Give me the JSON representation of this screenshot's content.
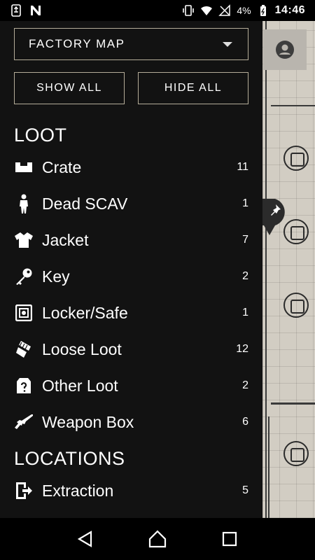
{
  "status_bar": {
    "battery_percent": "4%",
    "time": "14:46",
    "icons": [
      "usb-icon",
      "n-icon",
      "vibrate-icon",
      "wifi-icon",
      "no-signal-icon",
      "battery-icon"
    ]
  },
  "drawer": {
    "map_selector": {
      "value": "FACTORY MAP"
    },
    "show_all_label": "SHOW ALL",
    "hide_all_label": "HIDE ALL",
    "sections": [
      {
        "title": "LOOT",
        "items": [
          {
            "label": "Crate",
            "count": "11",
            "icon": "crate-icon"
          },
          {
            "label": "Dead SCAV",
            "count": "1",
            "icon": "person-icon"
          },
          {
            "label": "Jacket",
            "count": "7",
            "icon": "shirt-icon"
          },
          {
            "label": "Key",
            "count": "2",
            "icon": "key-icon"
          },
          {
            "label": "Locker/Safe",
            "count": "1",
            "icon": "safe-icon"
          },
          {
            "label": "Loose Loot",
            "count": "12",
            "icon": "loose-loot-icon"
          },
          {
            "label": "Other Loot",
            "count": "2",
            "icon": "question-box-icon"
          },
          {
            "label": "Weapon Box",
            "count": "6",
            "icon": "rifle-icon"
          }
        ]
      },
      {
        "title": "LOCATIONS",
        "items": [
          {
            "label": "Extraction",
            "count": "5",
            "icon": "exit-door-icon"
          }
        ]
      }
    ]
  },
  "nav_bar": {
    "buttons": [
      "back-icon",
      "home-icon",
      "recents-icon"
    ]
  },
  "colors": {
    "drawer_bg": "#121212",
    "border": "#b5ad99",
    "map_bg": "#d2cdc3"
  }
}
